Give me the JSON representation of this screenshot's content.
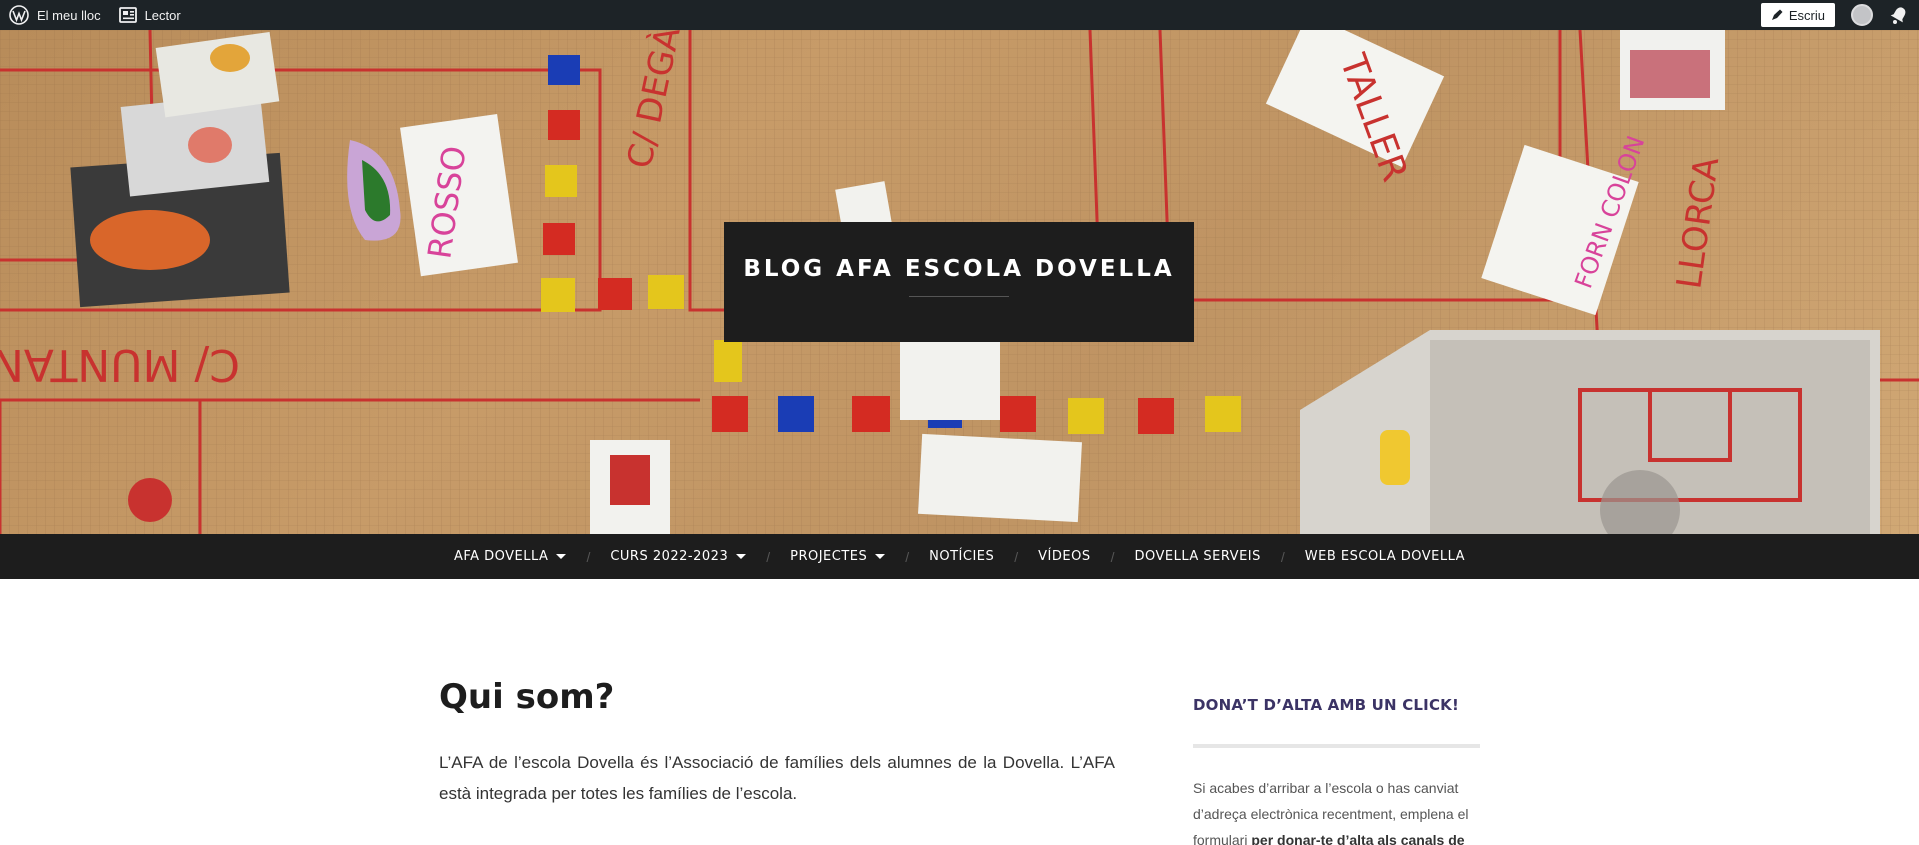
{
  "admin_bar": {
    "site_label": "El meu lloc",
    "reader_label": "Lector",
    "write_label": "Escriu"
  },
  "header": {
    "site_title": "BLOG AFA ESCOLA DOVELLA",
    "image_text": {
      "street_1": "C/ MUNTANYA",
      "street_2": "C/ DEGÀ",
      "card_1": "ROSSO",
      "card_2": "TALLER",
      "card_3": "FORN COLON",
      "street_3": "LLORCA"
    }
  },
  "nav": {
    "items": [
      {
        "label": "AFA DOVELLA",
        "has_submenu": true
      },
      {
        "label": "CURS 2022-2023",
        "has_submenu": true
      },
      {
        "label": "PROJECTES",
        "has_submenu": true
      },
      {
        "label": "NOTÍCIES",
        "has_submenu": false
      },
      {
        "label": "VÍDEOS",
        "has_submenu": false
      },
      {
        "label": "DOVELLA SERVEIS",
        "has_submenu": false
      },
      {
        "label": "WEB ESCOLA DOVELLA",
        "has_submenu": false
      }
    ]
  },
  "main": {
    "title": "Qui som?",
    "intro": "L’AFA de l’escola Dovella és l’Associació de famílies dels alumnes de la Dovella. L’AFA està integrada per totes les famílies de l’escola."
  },
  "sidebar": {
    "widget_title": "DONA’T D’ALTA AMB UN CLICK!",
    "widget_text": "Si acabes d’arribar a l’escola o has canviat d’adreça electrònica recentment, emplena el formulari ",
    "widget_link": "per donar-te d’alta als canals de"
  },
  "colors": {
    "admin_bar": "#1d2327",
    "nav_bar": "#1d1d1d",
    "widget_title": "#3b3365",
    "cardboard": "#c79b68"
  }
}
